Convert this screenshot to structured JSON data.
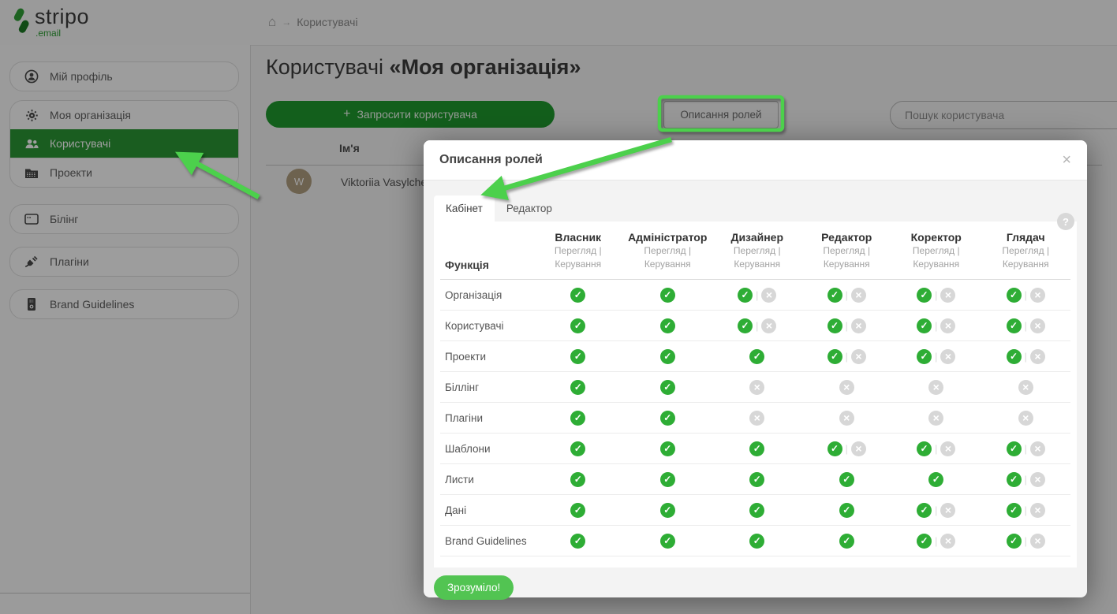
{
  "brand": {
    "name": "stripo",
    "tld": ".email"
  },
  "topbar": {
    "home_icon": "⌂",
    "breadcrumb_arrow": "→",
    "breadcrumb_current": "Користувачі"
  },
  "sidebar": {
    "items": [
      {
        "label": "Мій профіль",
        "icon": "user-circle-icon",
        "active": false
      },
      {
        "label": "Моя організація",
        "icon": "gear-icon",
        "active": false
      },
      {
        "label": "Користувачі",
        "icon": "users-icon",
        "active": true
      },
      {
        "label": "Проекти",
        "icon": "folder-icon",
        "active": false
      },
      {
        "label": "Білінг",
        "icon": "credit-card-icon",
        "active": false
      },
      {
        "label": "Плагіни",
        "icon": "plug-icon",
        "active": false
      },
      {
        "label": "Brand Guidelines",
        "icon": "brand-book-icon",
        "active": false
      }
    ]
  },
  "main": {
    "title_prefix": "Користувачі ",
    "title_org": "«Моя організація»",
    "invite_plus": "+",
    "invite_label": "Запросити користувача",
    "roles_button_label": "Описання ролей",
    "search_placeholder": "Пошук користувача",
    "users_table": {
      "name_header": "Ім'я",
      "row": {
        "avatar_initial": "W",
        "name": "Viktoriia Vasylche"
      }
    }
  },
  "modal": {
    "title": "Описання ролей",
    "close_icon": "×",
    "help_icon": "?",
    "tabs": [
      {
        "label": "Кабінет",
        "active": true
      },
      {
        "label": "Редактор",
        "active": false
      }
    ],
    "permissions_table": {
      "function_header": "Функція",
      "view_label": "Перегляд",
      "manage_label": "Керування",
      "roles": [
        "Власник",
        "Адміністратор",
        "Дизайнер",
        "Редактор",
        "Коректор",
        "Глядач"
      ],
      "rows": [
        {
          "feature": "Організація",
          "cells": [
            "check",
            "check",
            "check-x",
            "check-x",
            "check-x",
            "check-x"
          ]
        },
        {
          "feature": "Користувачі",
          "cells": [
            "check",
            "check",
            "check-x",
            "check-x",
            "check-x",
            "check-x"
          ]
        },
        {
          "feature": "Проекти",
          "cells": [
            "check",
            "check",
            "check",
            "check-x",
            "check-x",
            "check-x"
          ]
        },
        {
          "feature": "Біллінг",
          "cells": [
            "check",
            "check",
            "x",
            "x",
            "x",
            "x"
          ]
        },
        {
          "feature": "Плагіни",
          "cells": [
            "check",
            "check",
            "x",
            "x",
            "x",
            "x"
          ]
        },
        {
          "feature": "Шаблони",
          "cells": [
            "check",
            "check",
            "check",
            "check-x",
            "check-x",
            "check-x"
          ]
        },
        {
          "feature": "Листи",
          "cells": [
            "check",
            "check",
            "check",
            "check",
            "check",
            "check-x"
          ]
        },
        {
          "feature": "Дані",
          "cells": [
            "check",
            "check",
            "check",
            "check",
            "check-x",
            "check-x"
          ]
        },
        {
          "feature": "Brand Guidelines",
          "cells": [
            "check",
            "check",
            "check",
            "check",
            "check-x",
            "check-x"
          ]
        }
      ]
    },
    "ok_button": "Зрозуміло!"
  },
  "colors": {
    "sidebar_active_green": "#2a9634",
    "primary_button_green": "#1f9a2e",
    "check_green": "#2ead35",
    "cross_gray": "#d7d7d7",
    "ok_button_green": "#52c452",
    "annotation_green": "#4cd04c"
  }
}
